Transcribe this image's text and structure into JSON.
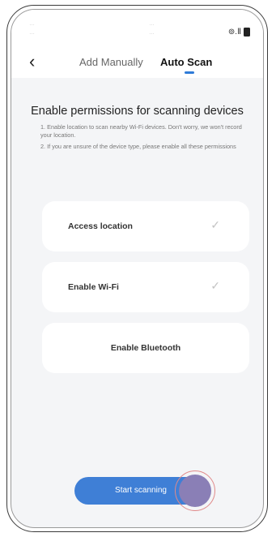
{
  "status_bar": {
    "faint_texts": [
      "…",
      "…",
      "…",
      "…"
    ],
    "signal_glyph": "⊚.Ⅱ",
    "icons": [
      "wifi-icon",
      "signal-icon",
      "battery-icon"
    ]
  },
  "header": {
    "back_glyph": "‹",
    "tabs": [
      {
        "label": "Add Manually",
        "active": false
      },
      {
        "label": "Auto Scan",
        "active": true
      }
    ],
    "accent_color": "#2f7bd8"
  },
  "permissions": {
    "title": "Enable permissions for scanning devices",
    "notes": [
      "1. Enable location to scan nearby Wi-Fi devices. Don't worry, we won't record your location.",
      "2. If you are unsure of the device type, please enable all these permissions"
    ],
    "items": [
      {
        "label": "Access location",
        "check": "✓",
        "enabled": true
      },
      {
        "label": "Enable Wi-Fi",
        "check": "✓",
        "enabled": true
      },
      {
        "label": "Enable Bluetooth",
        "check": "",
        "enabled": false
      }
    ]
  },
  "actions": {
    "start_scanning_label": "Start scanning",
    "button_color": "#3f7fd6"
  }
}
